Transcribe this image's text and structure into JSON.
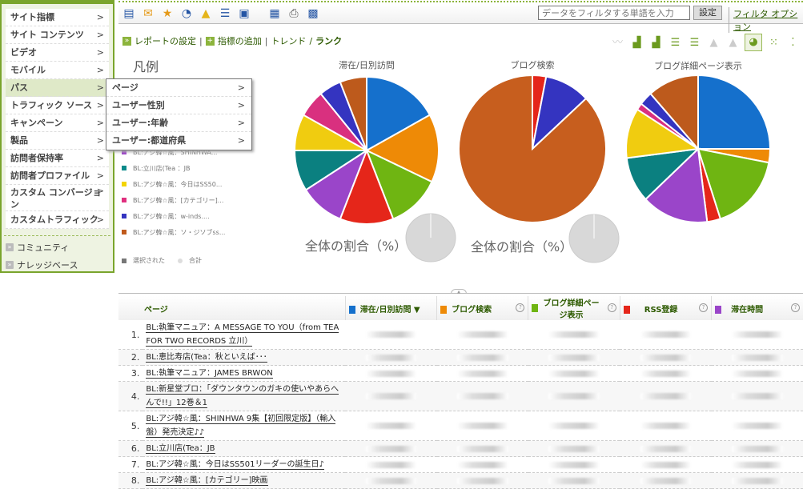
{
  "sidebar": {
    "items": [
      {
        "label": "サイト指標"
      },
      {
        "label": "サイト コンテンツ"
      },
      {
        "label": "ビデオ"
      },
      {
        "label": "モバイル"
      },
      {
        "label": "パス",
        "active": true
      },
      {
        "label": "トラフィック ソース"
      },
      {
        "label": "キャンペーン"
      },
      {
        "label": "製品"
      },
      {
        "label": "訪問者保持率"
      },
      {
        "label": "訪問者プロファイル"
      },
      {
        "label": "カスタム コンバージョン"
      },
      {
        "label": "カスタムトラフィック"
      }
    ],
    "chevron": ">",
    "links": [
      {
        "label": "コミュニティ"
      },
      {
        "label": "ナレッジベース"
      }
    ]
  },
  "flyout": {
    "items": [
      {
        "label": "ページ"
      },
      {
        "label": "ユーザー性別"
      },
      {
        "label": "ユーザー:年齢"
      },
      {
        "label": "ユーザー:都道府県"
      }
    ]
  },
  "toolbar": {
    "filter_placeholder": "データをフィルタする単語を入力",
    "set_label": "設定",
    "filter_options": "フィルタ オプション"
  },
  "actions": {
    "report_settings": "レポートの設定",
    "add_metric": "指標の追加",
    "trend": "トレンド",
    "rank": "ランク",
    "sep": "|",
    "slash": "/"
  },
  "legend": {
    "title": "凡例",
    "items": [
      {
        "label": "BL:アジ韓☆風：SHINHWA...",
        "color": "#9b3fc9"
      },
      {
        "label": "BL:立川店(Tea ：JB",
        "color": "#0a8a8a"
      },
      {
        "label": "BL:アジ韓☆風：今日はSS50...",
        "color": "#f3d400"
      },
      {
        "label": "BL:アジ韓☆風：[カテゴリー]...",
        "color": "#e0307f"
      },
      {
        "label": "BL:アジ韓☆風：w-inds....",
        "color": "#3434c0"
      },
      {
        "label": "BL:アジ韓☆風：ソ・ジソブss...",
        "color": "#c05a1c"
      }
    ],
    "selected": "選択された",
    "total": "合計"
  },
  "chart_data": [
    {
      "type": "pie",
      "title": "滞在/日別訪問",
      "colors": [
        "#1570cc",
        "#ee8a06",
        "#6fb512",
        "#e5261a",
        "#9a45c9",
        "#0b8080",
        "#f0cc10",
        "#d9307f",
        "#3434c0",
        "#bd5a1c"
      ],
      "values": [
        17,
        15,
        12,
        12,
        10,
        9,
        8,
        6,
        5,
        6
      ]
    },
    {
      "type": "pie",
      "title": "ブログ検索",
      "colors": [
        "#e5261a",
        "#3434c0",
        "#c75e1e"
      ],
      "values": [
        3,
        10,
        87
      ]
    },
    {
      "type": "pie",
      "title": "ブログ詳細ページ表示",
      "colors": [
        "#1570cc",
        "#ee8a06",
        "#6fb512",
        "#e5261a",
        "#9a45c9",
        "#0b8080",
        "#f0cc10",
        "#d9307f",
        "#3434c0",
        "#bd5a1c"
      ],
      "values": [
        25,
        3,
        17,
        3,
        15,
        10,
        11,
        1.5,
        3,
        11.5
      ]
    }
  ],
  "share_label": "全体の割合（%）",
  "table": {
    "headers": [
      {
        "label": "ページ"
      },
      {
        "label": "滞在/日別訪問 ▼",
        "color": "#1570cc"
      },
      {
        "label": "ブログ検索",
        "color": "#ee8a06"
      },
      {
        "label": "ブログ詳細ページ表示",
        "color": "#6fb512"
      },
      {
        "label": "RSS登録",
        "color": "#e5261a"
      },
      {
        "label": "滞在時間",
        "color": "#9a45c9"
      }
    ],
    "help": "?",
    "rows": [
      {
        "num": "1.",
        "page": "BL:執筆マニュア：A MESSAGE TO YOU（from TEA FOR TWO RECORDS 立川）"
      },
      {
        "num": "2.",
        "page": "BL:恵比寿店(Tea：秋といえば･･･"
      },
      {
        "num": "3.",
        "page": "BL:執筆マニュア：JAMES BRWON"
      },
      {
        "num": "4.",
        "page": "BL:新星堂ブロ：「ダウンタウンのガキの使いやあらへんで!!」12巻＆1"
      },
      {
        "num": "5.",
        "page": "BL:アジ韓☆風：SHINHWA 9集【初回限定版】（輸入盤）発売決定♪♪"
      },
      {
        "num": "6.",
        "page": "BL:立川店(Tea：JB"
      },
      {
        "num": "7.",
        "page": "BL:アジ韓☆風：今日はSS501リーダーの誕生日♪"
      },
      {
        "num": "8.",
        "page": "BL:アジ韓☆風：[カテゴリー]映画"
      }
    ]
  }
}
